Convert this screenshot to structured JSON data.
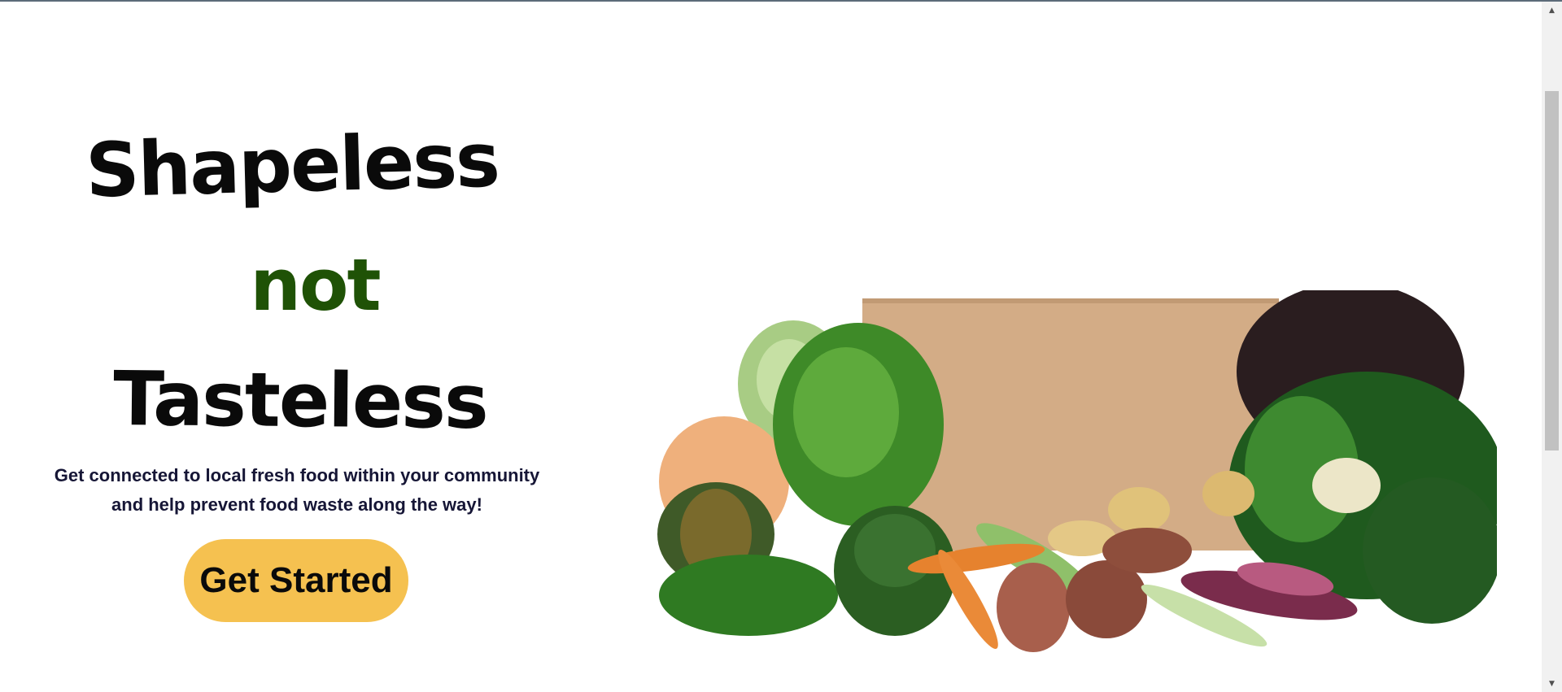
{
  "hero": {
    "headline_line1": "Shapeless",
    "headline_line2": "not",
    "headline_line3": "Tasteless",
    "tagline_line1": "Get connected to local fresh food within your community",
    "tagline_line2": "and help prevent food waste along the way!",
    "cta_label": "Get Started"
  },
  "colors": {
    "headline": "#0a0a0a",
    "accent_word": "#1f5206",
    "tagline": "#161636",
    "cta_background": "#f5c150"
  },
  "icons": {
    "scroll_up": "caret-up-icon",
    "scroll_down": "caret-down-icon"
  }
}
